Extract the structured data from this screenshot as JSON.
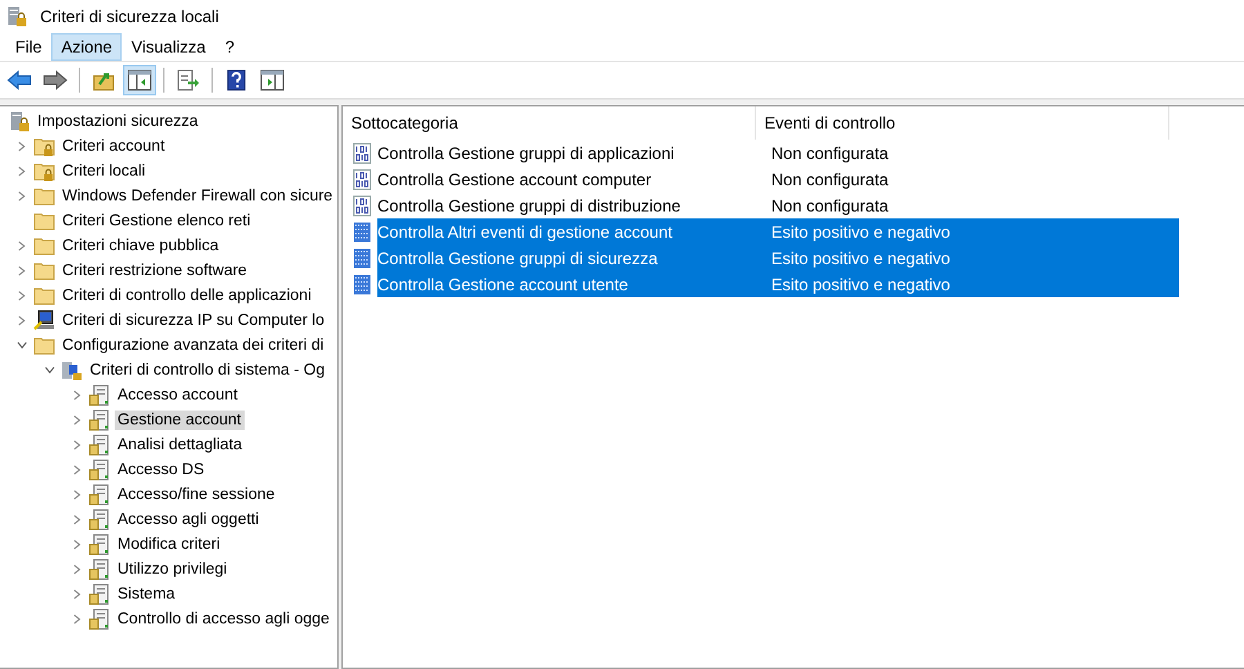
{
  "window": {
    "title": "Criteri di sicurezza locali"
  },
  "menu": [
    {
      "label": "File",
      "selected": false
    },
    {
      "label": "Azione",
      "selected": true
    },
    {
      "label": "Visualizza",
      "selected": false
    },
    {
      "label": "?",
      "selected": false
    }
  ],
  "toolbar": [
    {
      "kind": "back",
      "pressed": false
    },
    {
      "kind": "forward",
      "pressed": false
    },
    {
      "kind": "sep"
    },
    {
      "kind": "up",
      "pressed": false
    },
    {
      "kind": "tree",
      "pressed": true
    },
    {
      "kind": "sep"
    },
    {
      "kind": "export",
      "pressed": false
    },
    {
      "kind": "sep"
    },
    {
      "kind": "help",
      "pressed": false
    },
    {
      "kind": "pane",
      "pressed": false
    }
  ],
  "tree": {
    "label": "Impostazioni sicurezza",
    "kind": "root",
    "selected": false,
    "children": [
      {
        "label": "Criteri account",
        "kind": "lockfolder",
        "expanded": false,
        "selected": false
      },
      {
        "label": "Criteri locali",
        "kind": "lockfolder",
        "expanded": false,
        "selected": false
      },
      {
        "label": "Windows Defender Firewall con sicure",
        "kind": "folder",
        "expanded": false,
        "selected": false
      },
      {
        "label": "Criteri Gestione elenco reti",
        "kind": "folder",
        "selected": false
      },
      {
        "label": "Criteri chiave pubblica",
        "kind": "folder",
        "expanded": false,
        "selected": false
      },
      {
        "label": "Criteri restrizione software",
        "kind": "folder",
        "expanded": false,
        "selected": false
      },
      {
        "label": "Criteri di controllo delle applicazioni",
        "kind": "folder",
        "expanded": false,
        "selected": false
      },
      {
        "label": "Criteri di sicurezza IP su Computer lo",
        "kind": "ipsec",
        "expanded": false,
        "selected": false
      },
      {
        "label": "Configurazione avanzata dei criteri di",
        "kind": "folder",
        "expanded": true,
        "selected": false,
        "children": [
          {
            "label": "Criteri di controllo di sistema - Og",
            "kind": "audit",
            "expanded": true,
            "selected": false,
            "children": [
              {
                "label": "Accesso account",
                "kind": "policy",
                "expanded": false,
                "selected": false
              },
              {
                "label": "Gestione account",
                "kind": "policy",
                "expanded": false,
                "selected": true
              },
              {
                "label": "Analisi dettagliata",
                "kind": "policy",
                "expanded": false,
                "selected": false
              },
              {
                "label": "Accesso DS",
                "kind": "policy",
                "expanded": false,
                "selected": false
              },
              {
                "label": "Accesso/fine sessione",
                "kind": "policy",
                "expanded": false,
                "selected": false
              },
              {
                "label": "Accesso agli oggetti",
                "kind": "policy",
                "expanded": false,
                "selected": false
              },
              {
                "label": "Modifica criteri",
                "kind": "policy",
                "expanded": false,
                "selected": false
              },
              {
                "label": "Utilizzo privilegi",
                "kind": "policy",
                "expanded": false,
                "selected": false
              },
              {
                "label": "Sistema",
                "kind": "policy",
                "expanded": false,
                "selected": false
              },
              {
                "label": "Controllo di accesso agli ogge",
                "kind": "policy",
                "expanded": false,
                "selected": false
              }
            ]
          }
        ]
      }
    ]
  },
  "table": {
    "columns": [
      "Sottocategoria",
      "Eventi di controllo"
    ],
    "rows": [
      {
        "name": "Controlla Gestione gruppi di applicazioni",
        "value": "Non configurata",
        "configured": false,
        "selected": false
      },
      {
        "name": "Controlla Gestione account computer",
        "value": "Non configurata",
        "configured": false,
        "selected": false
      },
      {
        "name": "Controlla Gestione gruppi di distribuzione",
        "value": "Non configurata",
        "configured": false,
        "selected": false
      },
      {
        "name": "Controlla Altri eventi di gestione account",
        "value": "Esito positivo e negativo",
        "configured": true,
        "selected": true
      },
      {
        "name": "Controlla Gestione gruppi di sicurezza",
        "value": "Esito positivo e negativo",
        "configured": true,
        "selected": true
      },
      {
        "name": "Controlla Gestione account utente",
        "value": "Esito positivo e negativo",
        "configured": true,
        "selected": true
      }
    ]
  }
}
